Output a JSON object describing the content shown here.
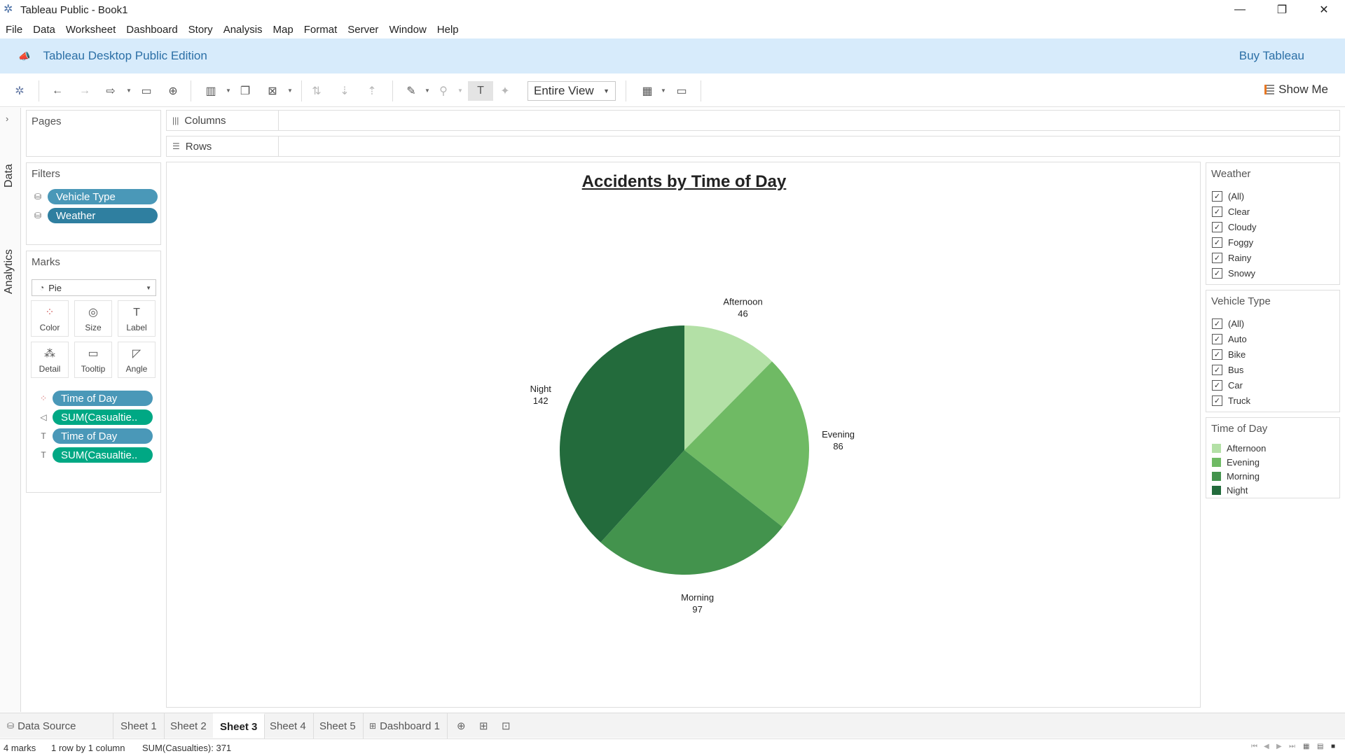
{
  "window": {
    "title": "Tableau Public - Book1",
    "minimize_glyph": "—",
    "maximize_glyph": "❐",
    "close_glyph": "✕"
  },
  "menu": [
    "File",
    "Data",
    "Worksheet",
    "Dashboard",
    "Story",
    "Analysis",
    "Map",
    "Format",
    "Server",
    "Window",
    "Help"
  ],
  "banner": {
    "edition": "Tableau Desktop Public Edition",
    "buy": "Buy Tableau",
    "color": "#d7ebfb"
  },
  "toolbar": {
    "fit_value": "Entire View",
    "show_me": "Show Me"
  },
  "side_tabs": {
    "data": "Data",
    "analytics": "Analytics"
  },
  "pages": {
    "header": "Pages"
  },
  "filters": {
    "header": "Filters",
    "items": [
      "Vehicle Type",
      "Weather"
    ]
  },
  "marks": {
    "header": "Marks",
    "type": "Pie",
    "buttons": [
      "Color",
      "Size",
      "Label",
      "Detail",
      "Tooltip",
      "Angle"
    ],
    "fields": [
      "Time of Day",
      "SUM(Casualtie..",
      "Time of Day",
      "SUM(Casualtie.."
    ]
  },
  "shelves": {
    "columns": "Columns",
    "rows": "Rows"
  },
  "chart_data": {
    "type": "pie",
    "title": "Accidents by Time of Day",
    "categories": [
      "Afternoon",
      "Evening",
      "Morning",
      "Night"
    ],
    "values": [
      46,
      86,
      97,
      142
    ],
    "colors": [
      "#b3e0a6",
      "#6fba64",
      "#43934d",
      "#236b3c"
    ],
    "legend_position": "right"
  },
  "weather_filter": {
    "header": "Weather",
    "items": [
      "(All)",
      "Clear",
      "Cloudy",
      "Foggy",
      "Rainy",
      "Snowy"
    ]
  },
  "vehicle_filter": {
    "header": "Vehicle Type",
    "items": [
      "(All)",
      "Auto",
      "Bike",
      "Bus",
      "Car",
      "Truck"
    ]
  },
  "legend": {
    "header": "Time of Day",
    "items": [
      "Afternoon",
      "Evening",
      "Morning",
      "Night"
    ]
  },
  "tabs": {
    "data_source": "Data Source",
    "sheets": [
      "Sheet 1",
      "Sheet 2",
      "Sheet 3",
      "Sheet 4",
      "Sheet 5"
    ],
    "active_sheet": "Sheet 3",
    "dashboard": "Dashboard 1"
  },
  "status": {
    "marks": "4 marks",
    "layout": "1 row by 1 column",
    "sum": "SUM(Casualties): 371"
  }
}
